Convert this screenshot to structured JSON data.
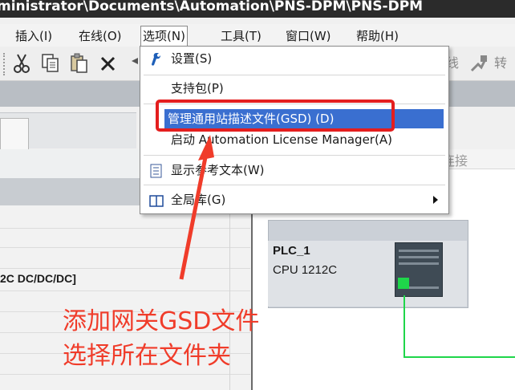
{
  "window": {
    "title": "ministrator\\Documents\\Automation\\PNS-DPM\\PNS-DPM"
  },
  "menubar": {
    "items": [
      {
        "label": "插入(I)"
      },
      {
        "label": "在线(O)"
      },
      {
        "label": "选项(N)"
      },
      {
        "label": "工具(T)"
      },
      {
        "label": "窗口(W)"
      },
      {
        "label": "帮助(H)"
      }
    ]
  },
  "toolbar": {
    "right_label_1": "线",
    "right_label_2": "转"
  },
  "options_menu": {
    "items": [
      {
        "label": "设置(S)",
        "icon": "wrench-icon"
      },
      {
        "label": "支持包(P)",
        "icon": ""
      },
      {
        "label": "管理通用站描述文件(GSD) (D)",
        "icon": "",
        "highlighted": true
      },
      {
        "label": "启动 Automation License Manager(A)",
        "icon": ""
      },
      {
        "label": "显示参考文本(W)",
        "icon": "reference-text-icon"
      },
      {
        "label": "全局库(G)",
        "icon": "library-icon",
        "submenu": true
      }
    ]
  },
  "device_view": {
    "header_label": "连接",
    "plc_name": "PLC_1",
    "plc_cpu": "CPU 1212C"
  },
  "left_panel": {
    "row_text": "2C DC/DC/DC]"
  },
  "annotation": {
    "line1": "添加网关GSD文件",
    "line2": "选择所在文件夹",
    "color": "#f03c2a"
  },
  "colors": {
    "highlight": "#3a6fd0",
    "annotation_box": "#e41e1e",
    "connection": "#1fd64a"
  }
}
